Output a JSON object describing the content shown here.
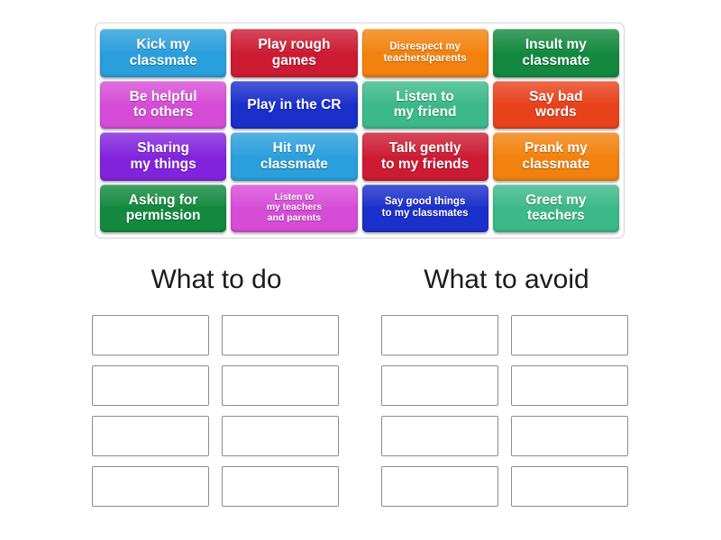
{
  "activity": {
    "type": "group-sort",
    "tile_bank": {
      "name": "word-tile-bank",
      "tiles": [
        {
          "text": "Kick my\nclassmate",
          "color": "#2a9fdc",
          "size": "lg"
        },
        {
          "text": "Play rough\ngames",
          "color": "#cc1b33",
          "size": "lg"
        },
        {
          "text": "Disrespect my\nteachers/parents",
          "color": "#f2820d",
          "size": "sm"
        },
        {
          "text": "Insult my\nclassmate",
          "color": "#13893f",
          "size": "lg"
        },
        {
          "text": "Be helpful\nto others",
          "color": "#d74cd7",
          "size": "lg"
        },
        {
          "text": "Play in the CR",
          "color": "#1b2fcb",
          "size": "lg"
        },
        {
          "text": "Listen to\nmy friend",
          "color": "#3cb98a",
          "size": "lg"
        },
        {
          "text": "Say bad\nwords",
          "color": "#e8421c",
          "size": "lg"
        },
        {
          "text": "Sharing\nmy things",
          "color": "#8223dd",
          "size": "lg"
        },
        {
          "text": "Hit my\nclassmate",
          "color": "#2a9fdc",
          "size": "lg"
        },
        {
          "text": "Talk gently\nto my friends",
          "color": "#cc1b33",
          "size": "lg"
        },
        {
          "text": "Prank my\nclassmate",
          "color": "#f2820d",
          "size": "lg"
        },
        {
          "text": "Asking for\npermission",
          "color": "#13893f",
          "size": "lg"
        },
        {
          "text": "Listen to\nmy teachers\nand parents",
          "color": "#d74cd7",
          "size": "xs"
        },
        {
          "text": "Say good things\nto my classmates",
          "color": "#1b2fcb",
          "size": "sm"
        },
        {
          "text": "Greet my\nteachers",
          "color": "#3cb98a",
          "size": "lg"
        }
      ]
    },
    "groups": [
      {
        "heading": "What to do",
        "name": "group-what-to-do",
        "dropzones": [
          "",
          "",
          "",
          "",
          "",
          "",
          "",
          ""
        ]
      },
      {
        "heading": "What to avoid",
        "name": "group-what-to-avoid",
        "dropzones": [
          "",
          "",
          "",
          "",
          "",
          "",
          "",
          ""
        ]
      }
    ],
    "colors": {
      "blue": "#2a9fdc",
      "red": "#cc1b33",
      "orange": "#f2820d",
      "green": "#13893f",
      "magenta": "#d74cd7",
      "deep_blue": "#1b2fcb",
      "emerald": "#3cb98a",
      "orange_red": "#e8421c",
      "purple": "#8223dd",
      "dropzone_border": "#8c8c8c",
      "bank_border": "#d4d4d4",
      "heading_text": "#1c1c1c",
      "tile_text": "#ffffff"
    }
  }
}
